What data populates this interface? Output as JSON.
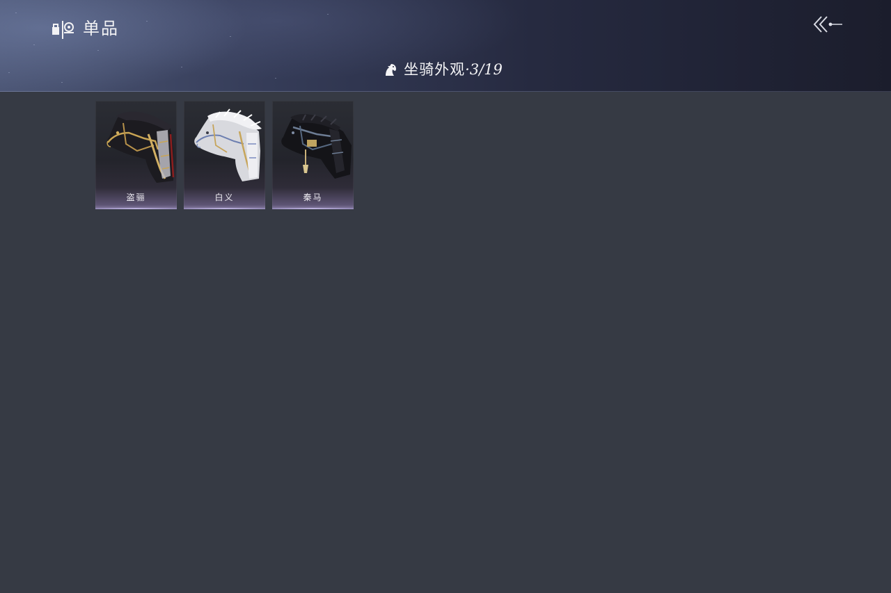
{
  "header": {
    "title": "单品",
    "title_icon": "collection-icon",
    "back_icon": "back-arrow-icon"
  },
  "section": {
    "icon": "horse-icon",
    "label": "坐骑外观",
    "count": "·3/19"
  },
  "items": [
    {
      "name": "盗骊",
      "coat": "black-gold"
    },
    {
      "name": "白义",
      "coat": "white-silver"
    },
    {
      "name": "秦马",
      "coat": "black-steel"
    }
  ],
  "colors": {
    "background": "#363a44",
    "header_dark": "#1b1d2c",
    "card_glow": "#8a7fa6",
    "text": "#f2f2f4"
  }
}
